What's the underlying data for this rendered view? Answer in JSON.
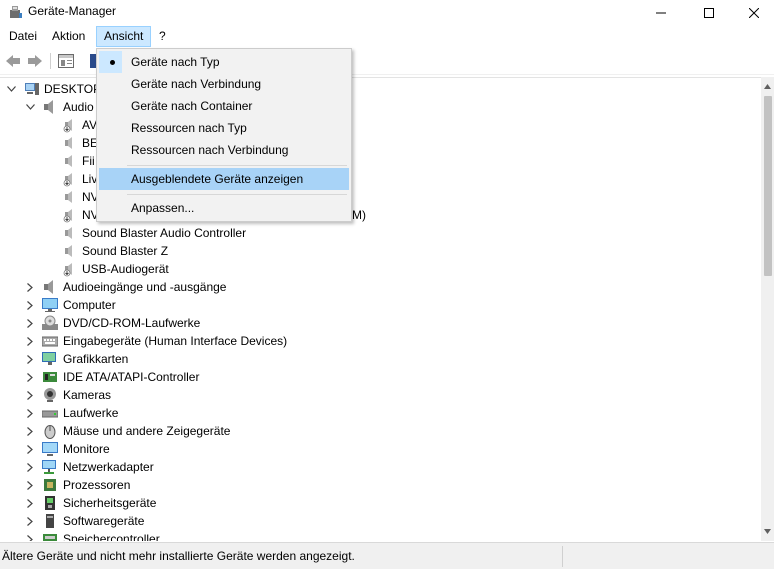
{
  "window": {
    "title": "Geräte-Manager",
    "icons": {
      "app": "device-manager-icon",
      "minimize": "minimize-icon",
      "maximize": "maximize-icon",
      "close": "close-icon"
    }
  },
  "menubar": {
    "items": [
      "Datei",
      "Aktion",
      "Ansicht",
      "?"
    ]
  },
  "toolbar": {
    "icons": [
      "back-arrow-icon",
      "forward-arrow-icon",
      "properties-icon",
      "device-icon"
    ]
  },
  "ansicht_menu": {
    "items": [
      {
        "label": "Geräte nach Typ",
        "checked": true
      },
      {
        "label": "Geräte nach Verbindung"
      },
      {
        "label": "Geräte nach Container"
      },
      {
        "label": "Ressourcen nach Typ"
      },
      {
        "label": "Ressourcen nach Verbindung"
      },
      {
        "label": "Ausgeblendete Geräte anzeigen",
        "highlighted": true
      },
      {
        "label": "Anpassen..."
      }
    ],
    "highlight_color": "#a8d3f7"
  },
  "tree": {
    "root": "DESKTOP-",
    "category_expanded": "Audio",
    "audio_children": [
      "AV",
      "BE",
      "Fii",
      "Liv",
      "NV",
      "NV",
      "Sound Blaster Audio Controller",
      "Sound Blaster Z",
      "USB-Audiogerät"
    ],
    "audio_child_tail": "M)",
    "categories": [
      {
        "label": "Audioeingänge und -ausgänge",
        "icon": "audio-io-icon"
      },
      {
        "label": "Computer",
        "icon": "computer-icon"
      },
      {
        "label": "DVD/CD-ROM-Laufwerke",
        "icon": "dvd-drive-icon"
      },
      {
        "label": "Eingabegeräte (Human Interface Devices)",
        "icon": "hid-icon"
      },
      {
        "label": "Grafikkarten",
        "icon": "display-adapter-icon"
      },
      {
        "label": "IDE ATA/ATAPI-Controller",
        "icon": "ide-controller-icon"
      },
      {
        "label": "Kameras",
        "icon": "camera-icon"
      },
      {
        "label": "Laufwerke",
        "icon": "disk-drive-icon"
      },
      {
        "label": "Mäuse und andere Zeigegeräte",
        "icon": "mouse-icon"
      },
      {
        "label": "Monitore",
        "icon": "monitor-icon"
      },
      {
        "label": "Netzwerkadapter",
        "icon": "network-adapter-icon"
      },
      {
        "label": "Prozessoren",
        "icon": "processor-icon"
      },
      {
        "label": "Sicherheitsgeräte",
        "icon": "security-device-icon"
      },
      {
        "label": "Softwaregeräte",
        "icon": "software-device-icon"
      },
      {
        "label": "Speichercontroller",
        "icon": "storage-controller-icon"
      }
    ]
  },
  "statusbar": {
    "text": "Ältere Geräte und nicht mehr installierte Geräte werden angezeigt."
  }
}
